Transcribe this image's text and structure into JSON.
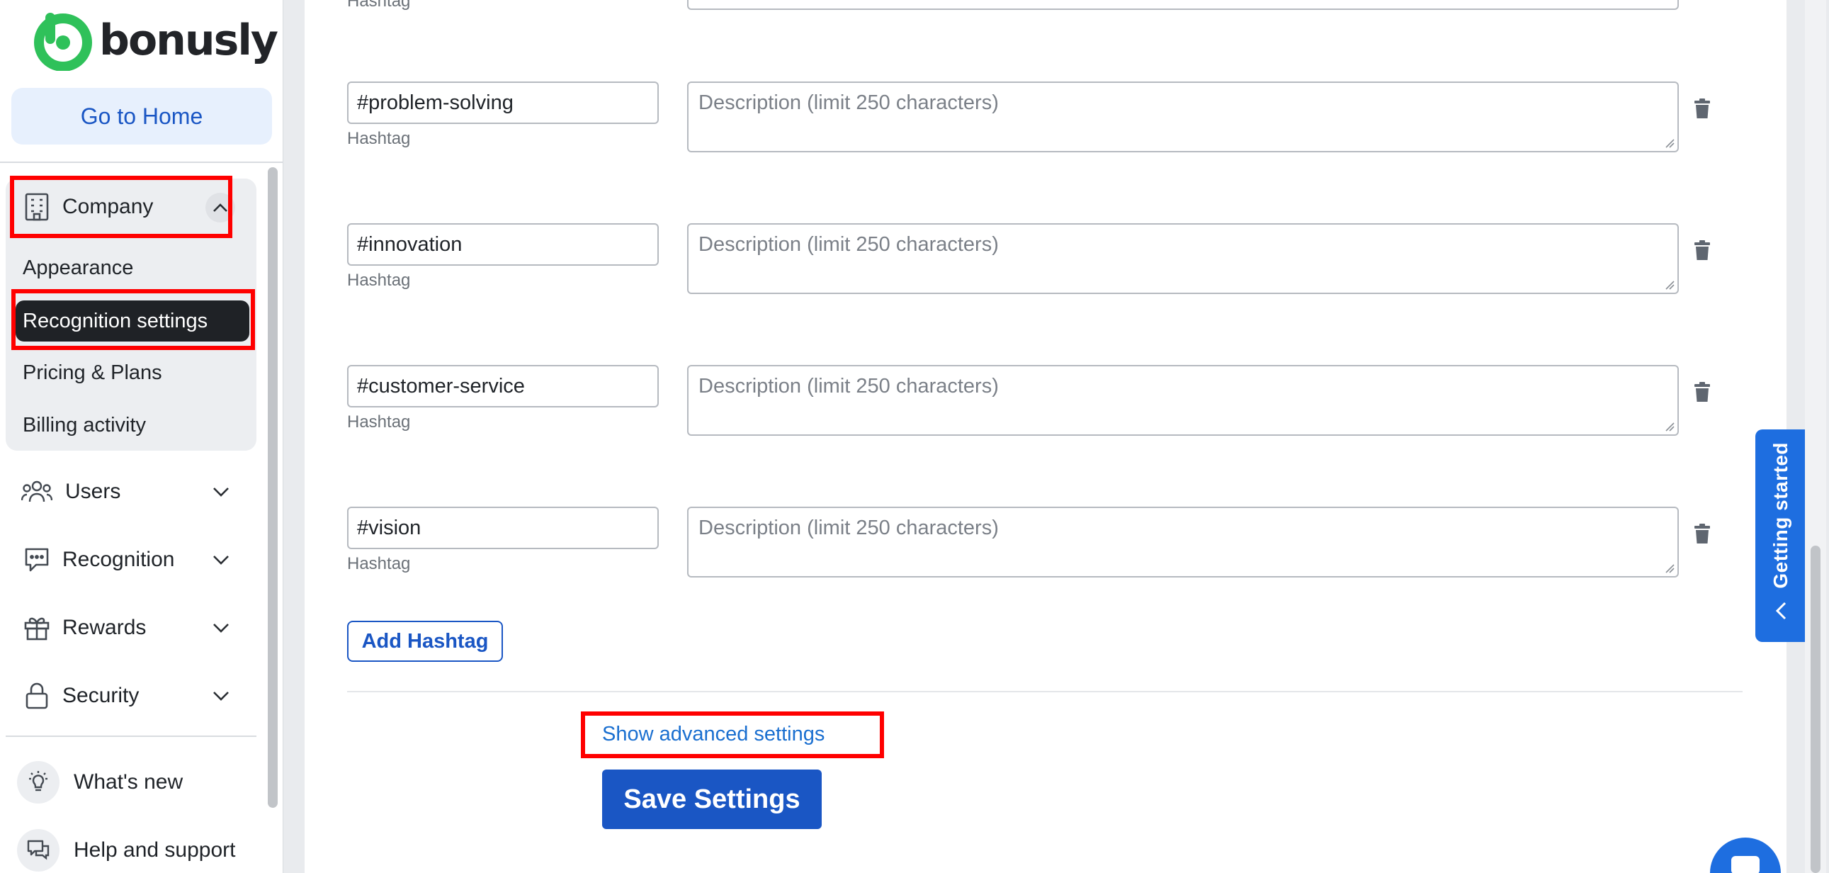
{
  "brand": {
    "name": "bonusly",
    "accent": "#1a56c4",
    "logo_color": "#2fc15a"
  },
  "sidebar": {
    "go_home": "Go to Home",
    "company": {
      "label": "Company",
      "expanded": true,
      "items": [
        {
          "label": "Appearance",
          "active": false
        },
        {
          "label": "Recognition settings",
          "active": true
        },
        {
          "label": "Pricing & Plans",
          "active": false
        },
        {
          "label": "Billing activity",
          "active": false
        }
      ]
    },
    "sections": [
      {
        "label": "Users",
        "icon": "users-icon"
      },
      {
        "label": "Recognition",
        "icon": "chat-icon"
      },
      {
        "label": "Rewards",
        "icon": "gift-icon"
      },
      {
        "label": "Security",
        "icon": "lock-icon"
      }
    ],
    "footer": [
      {
        "label": "What's new",
        "icon": "lightbulb-icon"
      },
      {
        "label": "Help and support",
        "icon": "support-chat-icon"
      }
    ]
  },
  "hashtags": {
    "field_label": "Hashtag",
    "description_placeholder": "Description (limit 250 characters)",
    "rows": [
      {
        "value": "#problem-solving",
        "description": ""
      },
      {
        "value": "#innovation",
        "description": ""
      },
      {
        "value": "#customer-service",
        "description": ""
      },
      {
        "value": "#vision",
        "description": ""
      }
    ],
    "add_label": "Add Hashtag"
  },
  "actions": {
    "advanced_link": "Show advanced settings",
    "save_label": "Save Settings"
  },
  "getting_started": {
    "label": "Getting started"
  }
}
